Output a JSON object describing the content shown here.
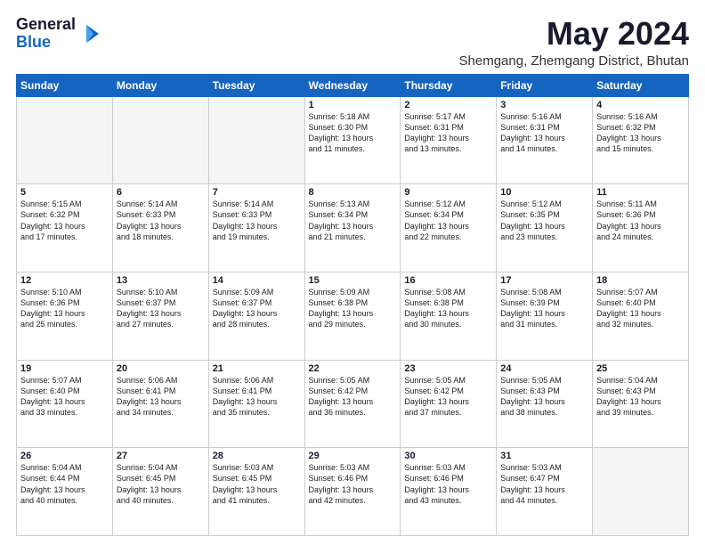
{
  "header": {
    "logo": {
      "line1": "General",
      "line2": "Blue"
    },
    "month": "May 2024",
    "location": "Shemgang, Zhemgang District, Bhutan"
  },
  "weekdays": [
    "Sunday",
    "Monday",
    "Tuesday",
    "Wednesday",
    "Thursday",
    "Friday",
    "Saturday"
  ],
  "weeks": [
    [
      {
        "day": "",
        "info": ""
      },
      {
        "day": "",
        "info": ""
      },
      {
        "day": "",
        "info": ""
      },
      {
        "day": "1",
        "info": "Sunrise: 5:18 AM\nSunset: 6:30 PM\nDaylight: 13 hours\nand 11 minutes."
      },
      {
        "day": "2",
        "info": "Sunrise: 5:17 AM\nSunset: 6:31 PM\nDaylight: 13 hours\nand 13 minutes."
      },
      {
        "day": "3",
        "info": "Sunrise: 5:16 AM\nSunset: 6:31 PM\nDaylight: 13 hours\nand 14 minutes."
      },
      {
        "day": "4",
        "info": "Sunrise: 5:16 AM\nSunset: 6:32 PM\nDaylight: 13 hours\nand 15 minutes."
      }
    ],
    [
      {
        "day": "5",
        "info": "Sunrise: 5:15 AM\nSunset: 6:32 PM\nDaylight: 13 hours\nand 17 minutes."
      },
      {
        "day": "6",
        "info": "Sunrise: 5:14 AM\nSunset: 6:33 PM\nDaylight: 13 hours\nand 18 minutes."
      },
      {
        "day": "7",
        "info": "Sunrise: 5:14 AM\nSunset: 6:33 PM\nDaylight: 13 hours\nand 19 minutes."
      },
      {
        "day": "8",
        "info": "Sunrise: 5:13 AM\nSunset: 6:34 PM\nDaylight: 13 hours\nand 21 minutes."
      },
      {
        "day": "9",
        "info": "Sunrise: 5:12 AM\nSunset: 6:34 PM\nDaylight: 13 hours\nand 22 minutes."
      },
      {
        "day": "10",
        "info": "Sunrise: 5:12 AM\nSunset: 6:35 PM\nDaylight: 13 hours\nand 23 minutes."
      },
      {
        "day": "11",
        "info": "Sunrise: 5:11 AM\nSunset: 6:36 PM\nDaylight: 13 hours\nand 24 minutes."
      }
    ],
    [
      {
        "day": "12",
        "info": "Sunrise: 5:10 AM\nSunset: 6:36 PM\nDaylight: 13 hours\nand 25 minutes."
      },
      {
        "day": "13",
        "info": "Sunrise: 5:10 AM\nSunset: 6:37 PM\nDaylight: 13 hours\nand 27 minutes."
      },
      {
        "day": "14",
        "info": "Sunrise: 5:09 AM\nSunset: 6:37 PM\nDaylight: 13 hours\nand 28 minutes."
      },
      {
        "day": "15",
        "info": "Sunrise: 5:09 AM\nSunset: 6:38 PM\nDaylight: 13 hours\nand 29 minutes."
      },
      {
        "day": "16",
        "info": "Sunrise: 5:08 AM\nSunset: 6:38 PM\nDaylight: 13 hours\nand 30 minutes."
      },
      {
        "day": "17",
        "info": "Sunrise: 5:08 AM\nSunset: 6:39 PM\nDaylight: 13 hours\nand 31 minutes."
      },
      {
        "day": "18",
        "info": "Sunrise: 5:07 AM\nSunset: 6:40 PM\nDaylight: 13 hours\nand 32 minutes."
      }
    ],
    [
      {
        "day": "19",
        "info": "Sunrise: 5:07 AM\nSunset: 6:40 PM\nDaylight: 13 hours\nand 33 minutes."
      },
      {
        "day": "20",
        "info": "Sunrise: 5:06 AM\nSunset: 6:41 PM\nDaylight: 13 hours\nand 34 minutes."
      },
      {
        "day": "21",
        "info": "Sunrise: 5:06 AM\nSunset: 6:41 PM\nDaylight: 13 hours\nand 35 minutes."
      },
      {
        "day": "22",
        "info": "Sunrise: 5:05 AM\nSunset: 6:42 PM\nDaylight: 13 hours\nand 36 minutes."
      },
      {
        "day": "23",
        "info": "Sunrise: 5:05 AM\nSunset: 6:42 PM\nDaylight: 13 hours\nand 37 minutes."
      },
      {
        "day": "24",
        "info": "Sunrise: 5:05 AM\nSunset: 6:43 PM\nDaylight: 13 hours\nand 38 minutes."
      },
      {
        "day": "25",
        "info": "Sunrise: 5:04 AM\nSunset: 6:43 PM\nDaylight: 13 hours\nand 39 minutes."
      }
    ],
    [
      {
        "day": "26",
        "info": "Sunrise: 5:04 AM\nSunset: 6:44 PM\nDaylight: 13 hours\nand 40 minutes."
      },
      {
        "day": "27",
        "info": "Sunrise: 5:04 AM\nSunset: 6:45 PM\nDaylight: 13 hours\nand 40 minutes."
      },
      {
        "day": "28",
        "info": "Sunrise: 5:03 AM\nSunset: 6:45 PM\nDaylight: 13 hours\nand 41 minutes."
      },
      {
        "day": "29",
        "info": "Sunrise: 5:03 AM\nSunset: 6:46 PM\nDaylight: 13 hours\nand 42 minutes."
      },
      {
        "day": "30",
        "info": "Sunrise: 5:03 AM\nSunset: 6:46 PM\nDaylight: 13 hours\nand 43 minutes."
      },
      {
        "day": "31",
        "info": "Sunrise: 5:03 AM\nSunset: 6:47 PM\nDaylight: 13 hours\nand 44 minutes."
      },
      {
        "day": "",
        "info": ""
      }
    ]
  ]
}
